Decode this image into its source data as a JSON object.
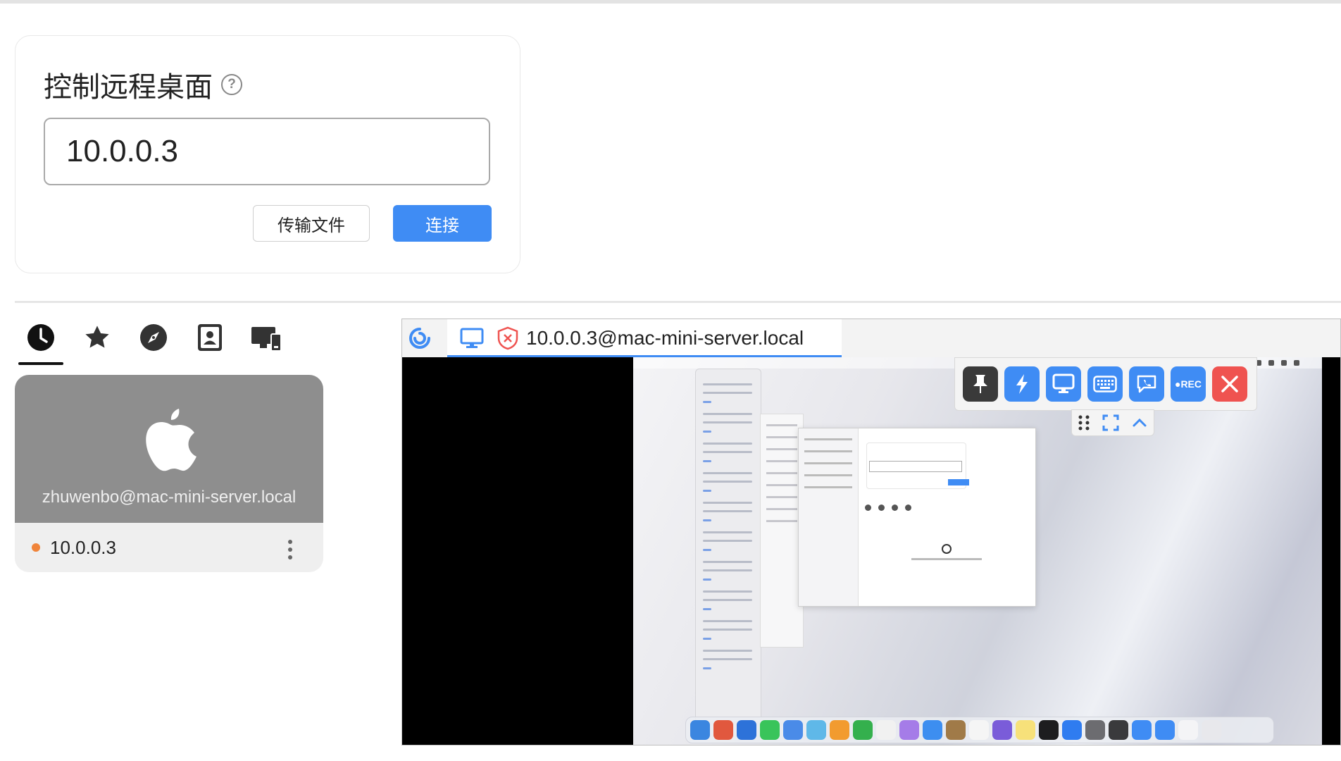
{
  "connect": {
    "title": "控制远程桌面",
    "id_value": "10.0.0.3",
    "transfer_label": "传输文件",
    "connect_label": "连接"
  },
  "tabs": [
    {
      "icon": "recent-icon",
      "active": true
    },
    {
      "icon": "favorites-star-icon",
      "active": false
    },
    {
      "icon": "discover-compass-icon",
      "active": false
    },
    {
      "icon": "address-book-icon",
      "active": false
    },
    {
      "icon": "lan-devices-icon",
      "active": false
    }
  ],
  "peer": {
    "os_icon": "apple-logo-icon",
    "username_host": "zhuwenbo@mac-mini-server.local",
    "id": "10.0.0.3",
    "status_color": "#f0843a"
  },
  "remote": {
    "tab_title": "10.0.0.3@mac-mini-server.local",
    "toolbar": {
      "rec_label": "●REC",
      "buttons": [
        "pin-icon",
        "action-bolt-icon",
        "display-icon",
        "keyboard-icon",
        "chat-icon",
        "record-icon",
        "close-icon"
      ]
    }
  },
  "colors": {
    "accent": "#3f8cf4",
    "danger": "#ef5350",
    "thumb_gray": "#8e8e8e",
    "toolbar_dark": "#3a3a3a"
  }
}
